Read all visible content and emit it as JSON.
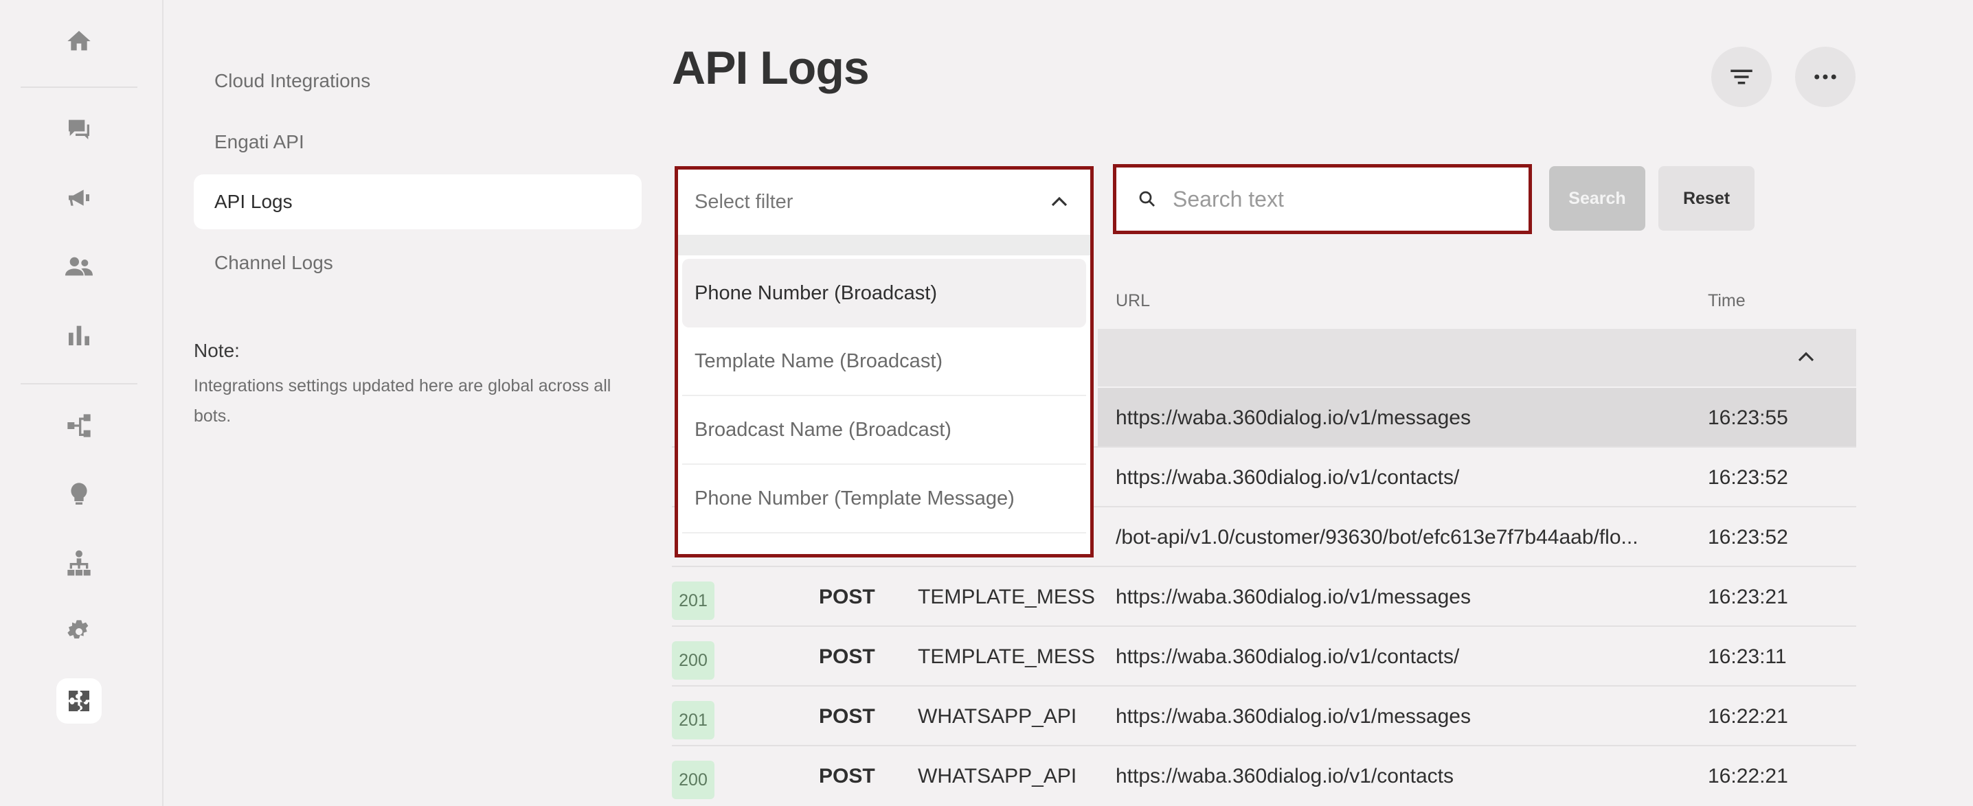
{
  "rail": {
    "icons": [
      "home-icon",
      "chat-icon",
      "megaphone-icon",
      "users-icon",
      "bar-chart-icon",
      "flow-icon",
      "lightbulb-icon",
      "hierarchy-icon",
      "gear-icon",
      "integrations-icon"
    ]
  },
  "subnav": {
    "items": [
      {
        "label": "Cloud Integrations"
      },
      {
        "label": "Engati API"
      },
      {
        "label": "API Logs"
      },
      {
        "label": "Channel Logs"
      }
    ],
    "note_title": "Note:",
    "note_text": "Integrations settings updated here are global across all bots."
  },
  "header": {
    "title": "API Logs"
  },
  "filter": {
    "placeholder": "Select filter",
    "options": [
      "Phone Number (Broadcast)",
      "Template Name (Broadcast)",
      "Broadcast Name (Broadcast)",
      "Phone Number (Template Message)"
    ]
  },
  "search": {
    "placeholder": "Search text",
    "search_label": "Search",
    "reset_label": "Reset"
  },
  "table": {
    "headers": {
      "url": "URL",
      "time": "Time"
    },
    "rows": [
      {
        "status": "",
        "method": "",
        "type": "",
        "url": "https://waba.360dialog.io/v1/messages",
        "time": "16:23:55"
      },
      {
        "status": "",
        "method": "",
        "type": "",
        "url": "https://waba.360dialog.io/v1/contacts/",
        "time": "16:23:52"
      },
      {
        "status": "",
        "method": "",
        "type": "",
        "url": "/bot-api/v1.0/customer/93630/bot/efc613e7f7b44aab/flo...",
        "time": "16:23:52"
      },
      {
        "status": "201",
        "method": "POST",
        "type": "TEMPLATE_MESS...",
        "url": "https://waba.360dialog.io/v1/messages",
        "time": "16:23:21"
      },
      {
        "status": "200",
        "method": "POST",
        "type": "TEMPLATE_MESS...",
        "url": "https://waba.360dialog.io/v1/contacts/",
        "time": "16:23:11"
      },
      {
        "status": "201",
        "method": "POST",
        "type": "WHATSAPP_API",
        "url": "https://waba.360dialog.io/v1/messages",
        "time": "16:22:21"
      },
      {
        "status": "200",
        "method": "POST",
        "type": "WHATSAPP_API",
        "url": "https://waba.360dialog.io/v1/contacts",
        "time": "16:22:21"
      }
    ]
  }
}
